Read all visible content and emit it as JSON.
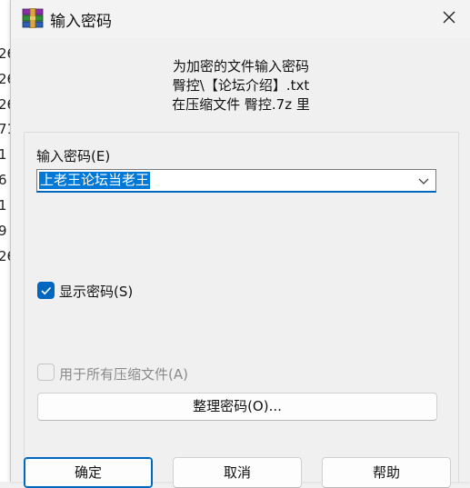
{
  "background": {
    "digits": [
      "26",
      "26",
      "26",
      "71",
      "1",
      "6",
      "1",
      "9",
      "26"
    ]
  },
  "dialog": {
    "title": "输入密码",
    "info_lines": [
      "为加密的文件输入密码",
      "臀控\\【论坛介绍】.txt",
      "在压缩文件 臀控.7z 里"
    ],
    "password_label": "输入密码(E)",
    "password_value": "上老王论坛当老王",
    "show_password": {
      "label": "显示密码(S)",
      "checked": true
    },
    "apply_all": {
      "label": "用于所有压缩文件(A)",
      "checked": false,
      "enabled": false
    },
    "organize_button": "整理密码(O)...",
    "ok_button": "确定",
    "cancel_button": "取消",
    "help_button": "帮助"
  },
  "icons": {
    "app": "winrar-icon",
    "close": "close-icon",
    "dropdown": "chevron-down-icon",
    "check": "checkmark-icon"
  },
  "colors": {
    "accent": "#0067c0",
    "selection": "#0078d7",
    "dialog_bg": "#f0f0f0"
  }
}
